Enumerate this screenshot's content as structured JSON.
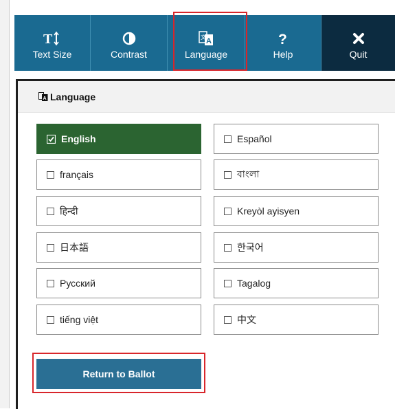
{
  "toolbar": {
    "text_size_label": "Text Size",
    "contrast_label": "Contrast",
    "language_label": "Language",
    "help_label": "Help",
    "quit_label": "Quit"
  },
  "panel": {
    "title": "Language"
  },
  "languages": [
    {
      "label": "English",
      "selected": true
    },
    {
      "label": "Español",
      "selected": false
    },
    {
      "label": "français",
      "selected": false
    },
    {
      "label": "বাংলা",
      "selected": false
    },
    {
      "label": "हिन्दी",
      "selected": false
    },
    {
      "label": "Kreyòl ayisyen",
      "selected": false
    },
    {
      "label": "日本語",
      "selected": false
    },
    {
      "label": "한국어",
      "selected": false
    },
    {
      "label": "Русский",
      "selected": false
    },
    {
      "label": "Tagalog",
      "selected": false
    },
    {
      "label": "tiếng việt",
      "selected": false
    },
    {
      "label": "中文",
      "selected": false
    }
  ],
  "return_button_label": "Return to Ballot",
  "colors": {
    "toolbar_blue": "#1a6a91",
    "quit_dark": "#0c2b40",
    "selected_green": "#2b6431",
    "return_blue": "#2a6f94",
    "highlight_red": "#d8262b"
  }
}
